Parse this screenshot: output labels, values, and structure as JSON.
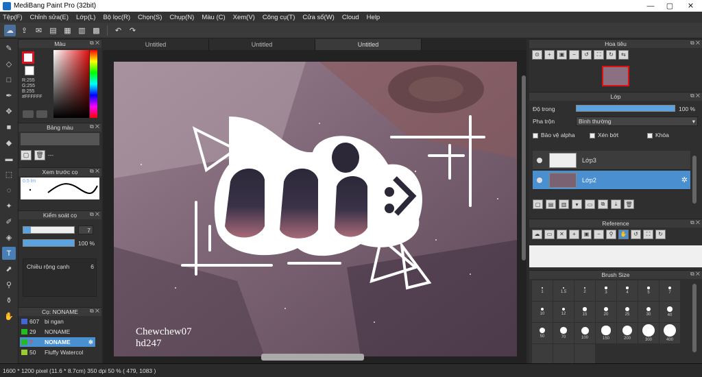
{
  "window": {
    "title": "MediBang Paint Pro (32bit)",
    "minimize_glyph": "—",
    "maximize_glyph": "▢",
    "close_glyph": "✕"
  },
  "menu": [
    "Tệp(F)",
    "Chỉnh sửa(E)",
    "Lớp(L)",
    "Bộ lọc(R)",
    "Chọn(S)",
    "Chụp(N)",
    "Màu (C)",
    "Xem(V)",
    "Công cụ(T)",
    "Cửa sổ(W)",
    "Cloud",
    "Help"
  ],
  "tabs": [
    "Untitled",
    "Untitled",
    "Untitled"
  ],
  "color_panel": {
    "title": "Màu",
    "rgb": [
      "R:255",
      "G:255",
      "B:255",
      "#FFFFFF"
    ]
  },
  "palette_panel": {
    "title": "Bảng màu",
    "dash": "---"
  },
  "preview_panel": {
    "title": "Xem trước cọ",
    "size_label": "0.5 lm"
  },
  "brush_control": {
    "title": "Kiểm soát cọ",
    "size_value": "7",
    "size_fill": 0.15,
    "opacity_label": "100 %",
    "opacity_fill": 1.0,
    "width_label": "Chiều rộng cạnh",
    "width_value": "6"
  },
  "brush_list": {
    "title": "Cọ: NONAME",
    "items": [
      {
        "num": "607",
        "name": "bi ngan",
        "color": "#4466dd"
      },
      {
        "num": "29",
        "name": "NONAME",
        "color": "#22bb22"
      },
      {
        "num": "7",
        "name": "NONAME",
        "color": "#22bb22"
      },
      {
        "num": "50",
        "name": "Fluffy Watercol",
        "color": "#99cc33"
      }
    ],
    "selected_index": 2
  },
  "navigator": {
    "title": "Hoa tiêu"
  },
  "layers": {
    "title": "Lớp",
    "opacity_label": "Độ trong",
    "opacity_value": "100 %",
    "blend_label": "Pha trộn",
    "blend_value": "Bình thường",
    "protect_alpha": "Bảo vệ alpha",
    "clipping": "Xén bớt",
    "lock": "Khóa",
    "items": [
      "Lớp3",
      "Lớp2"
    ]
  },
  "reference": {
    "title": "Reference"
  },
  "brush_size": {
    "title": "Brush Size",
    "sizes": [
      "1",
      "1.5",
      "2",
      "3",
      "4",
      "5",
      "7",
      "10",
      "12",
      "15",
      "20",
      "25",
      "30",
      "40",
      "50",
      "70",
      "100",
      "150",
      "200",
      "300",
      "400",
      "",
      "",
      ""
    ]
  },
  "artwork": {
    "signature_line1": "Chewchew07",
    "signature_line2": "hd247"
  },
  "status": {
    "text": "1600 * 1200 pixel   (11.6 * 8.7cm)   350 dpi   50 %   ( 479, 1083 )"
  },
  "colors": {
    "accent": "#4a90d0",
    "panel": "#2f2f2f",
    "foreground": "#e01010"
  }
}
